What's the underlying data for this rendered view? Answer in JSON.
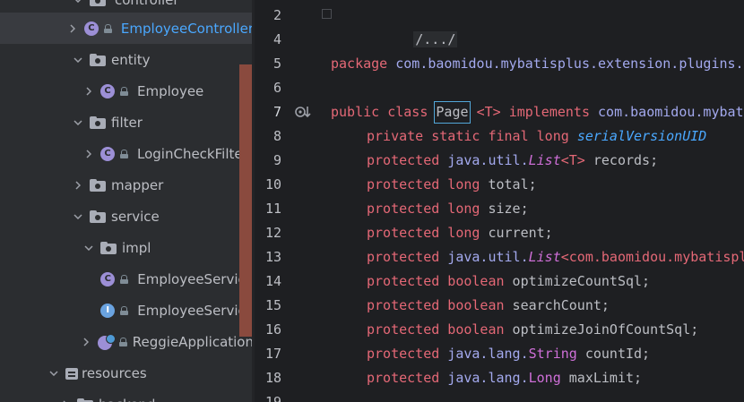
{
  "tree": {
    "items": [
      {
        "label": "controller",
        "icon": "package-folder-icon",
        "indent": 1,
        "expanded": true
      },
      {
        "label": "EmployeeController",
        "icon": "class-icon",
        "indent": 2,
        "expanded": false,
        "selected": true
      },
      {
        "label": "entity",
        "icon": "package-folder-icon",
        "indent": 1,
        "expanded": true
      },
      {
        "label": "Employee",
        "icon": "class-icon",
        "indent": 2,
        "expanded": false
      },
      {
        "label": "filter",
        "icon": "package-folder-icon",
        "indent": 1,
        "expanded": true
      },
      {
        "label": "LoginCheckFilter",
        "icon": "class-icon",
        "indent": 2,
        "expanded": false
      },
      {
        "label": "mapper",
        "icon": "package-folder-icon",
        "indent": 1,
        "expanded": false
      },
      {
        "label": "service",
        "icon": "package-folder-icon",
        "indent": 1,
        "expanded": true
      },
      {
        "label": "impl",
        "icon": "package-folder-icon",
        "indent": 2,
        "expanded": true
      },
      {
        "label": "EmployeeService",
        "icon": "class-icon",
        "indent": 3
      },
      {
        "label": "EmployeeService",
        "icon": "interface-icon",
        "indent": 2
      },
      {
        "label": "ReggieApplication",
        "icon": "spring-app-icon",
        "indent": 2,
        "expanded": false
      },
      {
        "label": "resources",
        "icon": "resources-folder-icon",
        "indent": 0,
        "expanded": true
      },
      {
        "label": "backend",
        "icon": "folder-icon",
        "indent": 1,
        "expanded": false
      }
    ]
  },
  "editor": {
    "line_numbers": [
      "2",
      "4",
      "5",
      "6",
      "7",
      "8",
      "9",
      "10",
      "11",
      "12",
      "13",
      "14",
      "15",
      "16",
      "17",
      "18",
      "19"
    ],
    "lines": {
      "l2": "/.../",
      "l5_kw": "package",
      "l5_rest": " com.baomidou.mybatisplus.extension.plugins.pagination;",
      "l7_kw1": "public",
      "l7_kw2": "class",
      "l7_name": "Page",
      "l7_tp": "<T>",
      "l7_impl": "implements",
      "l7_rest": " com.baomidou.mybatisplus.core.metadata.IPage<T> {",
      "l8_kw": "private static final long",
      "l8_fld": "serialVersionUID",
      "l9_kw": "protected",
      "l9_pkg": "java.util.",
      "l9_ty": "List",
      "l9_tp": "<T>",
      "l9_rest": " records;",
      "l10_kw": "protected long",
      "l10_rest": " total;",
      "l11_kw": "protected long",
      "l11_rest": " size;",
      "l12_kw": "protected long",
      "l12_rest": " current;",
      "l13_kw": "protected",
      "l13_pkg": "java.util.",
      "l13_ty": "List",
      "l13_rest": "<com.baomidou.mybatisplus.core.metadata.OrderItem> orders;",
      "l14_kw": "protected boolean",
      "l14_rest": " optimizeCountSql;",
      "l15_kw": "protected boolean",
      "l15_rest": " searchCount;",
      "l16_kw": "protected boolean",
      "l16_rest": " optimizeJoinOfCountSql;",
      "l17_kw": "protected",
      "l17_pkg": "java.lang.",
      "l17_ty": "String",
      "l17_rest": " countId;",
      "l18_kw": "protected",
      "l18_pkg": "java.lang.",
      "l18_ty": "Long",
      "l18_rest": " maxLimit;"
    }
  },
  "colors": {
    "keyword": "#e46876",
    "type": "#cf6fd8",
    "package": "#a3a9ee",
    "field": "#4aa8ff",
    "selected_label": "#4aa8ff",
    "tree_bg": "#2b2d30",
    "editor_bg": "#1e1f22"
  }
}
